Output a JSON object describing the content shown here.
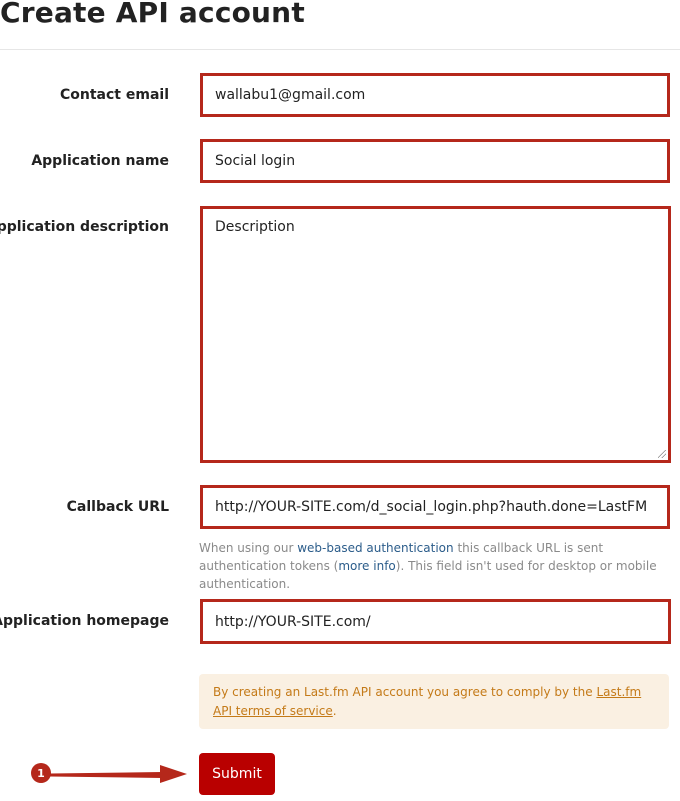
{
  "page": {
    "title": "Create API account"
  },
  "form": {
    "contact_email": {
      "label": "Contact email",
      "value": "wallabu1@gmail.com"
    },
    "app_name": {
      "label": "Application name",
      "value": "Social login"
    },
    "app_description": {
      "label": "Application description",
      "value": "Description"
    },
    "callback_url": {
      "label": "Callback URL",
      "value": "http://YOUR-SITE.com/d_social_login.php?hauth.done=LastFM",
      "help": {
        "pre": "When using our ",
        "link1": "web-based authentication",
        "mid1": " this callback URL is sent authentication tokens (",
        "link2": "more info",
        "post": "). This field isn't used for desktop or mobile authentication."
      }
    },
    "homepage": {
      "label": "Application homepage",
      "value": "http://YOUR-SITE.com/"
    }
  },
  "notice": {
    "pre": "By creating an Last.fm API account you agree to comply by the ",
    "link": "Last.fm API terms of service",
    "post": "."
  },
  "submit_label": "Submit",
  "annotation": {
    "step": "1"
  },
  "colors": {
    "highlight": "#b5281b",
    "submit": "#b90000",
    "notice_bg": "#faf0e2",
    "notice_text": "#c47a18",
    "link": "#2b5c8a"
  }
}
